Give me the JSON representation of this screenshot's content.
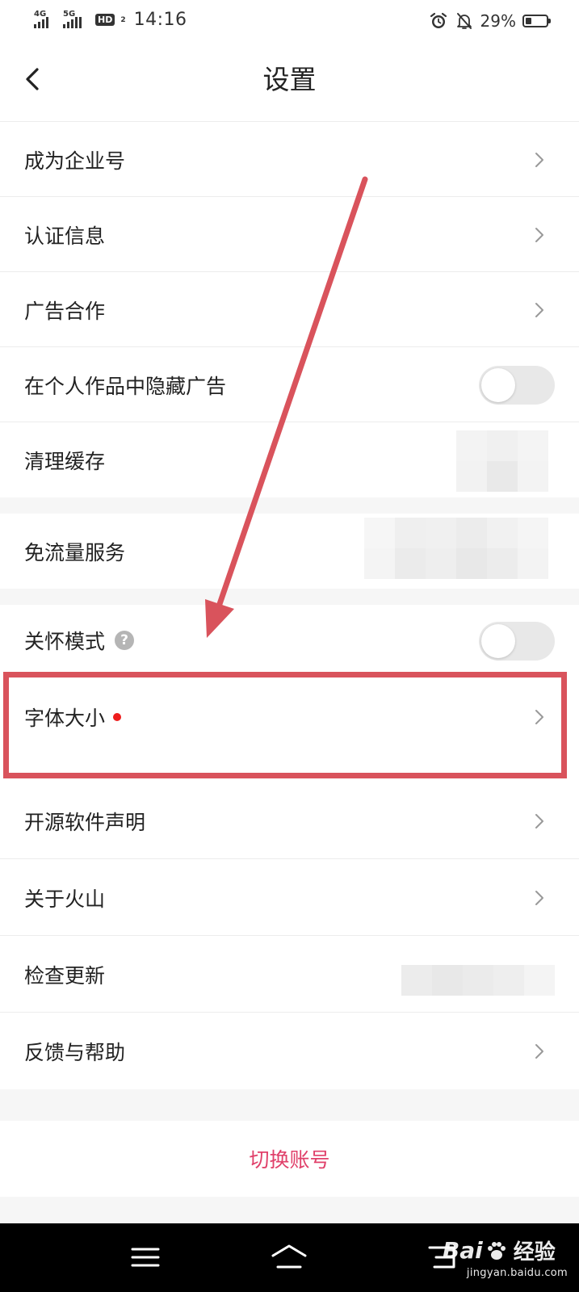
{
  "status_bar": {
    "signal1_label": "4G",
    "signal2_label": "5G",
    "hd_label": "HD",
    "hd_sub": "2",
    "time": "14:16",
    "battery_percent_text": "29%",
    "battery_level": 0.29
  },
  "header": {
    "title": "设置"
  },
  "settings": {
    "items": [
      {
        "label": "成为企业号",
        "control": "chevron"
      },
      {
        "label": "认证信息",
        "control": "chevron"
      },
      {
        "label": "广告合作",
        "control": "chevron"
      },
      {
        "label": "在个人作品中隐藏广告",
        "control": "toggle",
        "toggle_on": false
      },
      {
        "label": "清理缓存",
        "control": "mosaic"
      },
      {
        "label": "免流量服务",
        "control": "mosaic"
      },
      {
        "label": "关怀模式",
        "control": "toggle",
        "toggle_on": false
      },
      {
        "label": "字体大小",
        "control": "chevron"
      },
      {
        "label": "开源软件声明",
        "control": "chevron"
      },
      {
        "label": "关于火山",
        "control": "chevron"
      },
      {
        "label": "检查更新",
        "control": "mosaic"
      },
      {
        "label": "反馈与帮助",
        "control": "chevron"
      }
    ]
  },
  "switch_account": {
    "label": "切换账号"
  },
  "colors": {
    "accent": "#e0406a",
    "annotation_red": "#d9535c",
    "new_dot": "#ee1d1d"
  },
  "icons": {
    "back": "chevron-left-icon",
    "row_arrow": "chevron-right-icon",
    "help": "question-circle-icon",
    "nav_menu": "menu-icon",
    "nav_home": "home-icon",
    "nav_back": "back-icon"
  },
  "watermark": {
    "logo_text_left": "Bai",
    "logo_text_right": "经验",
    "url": "jingyan.baidu.com"
  }
}
